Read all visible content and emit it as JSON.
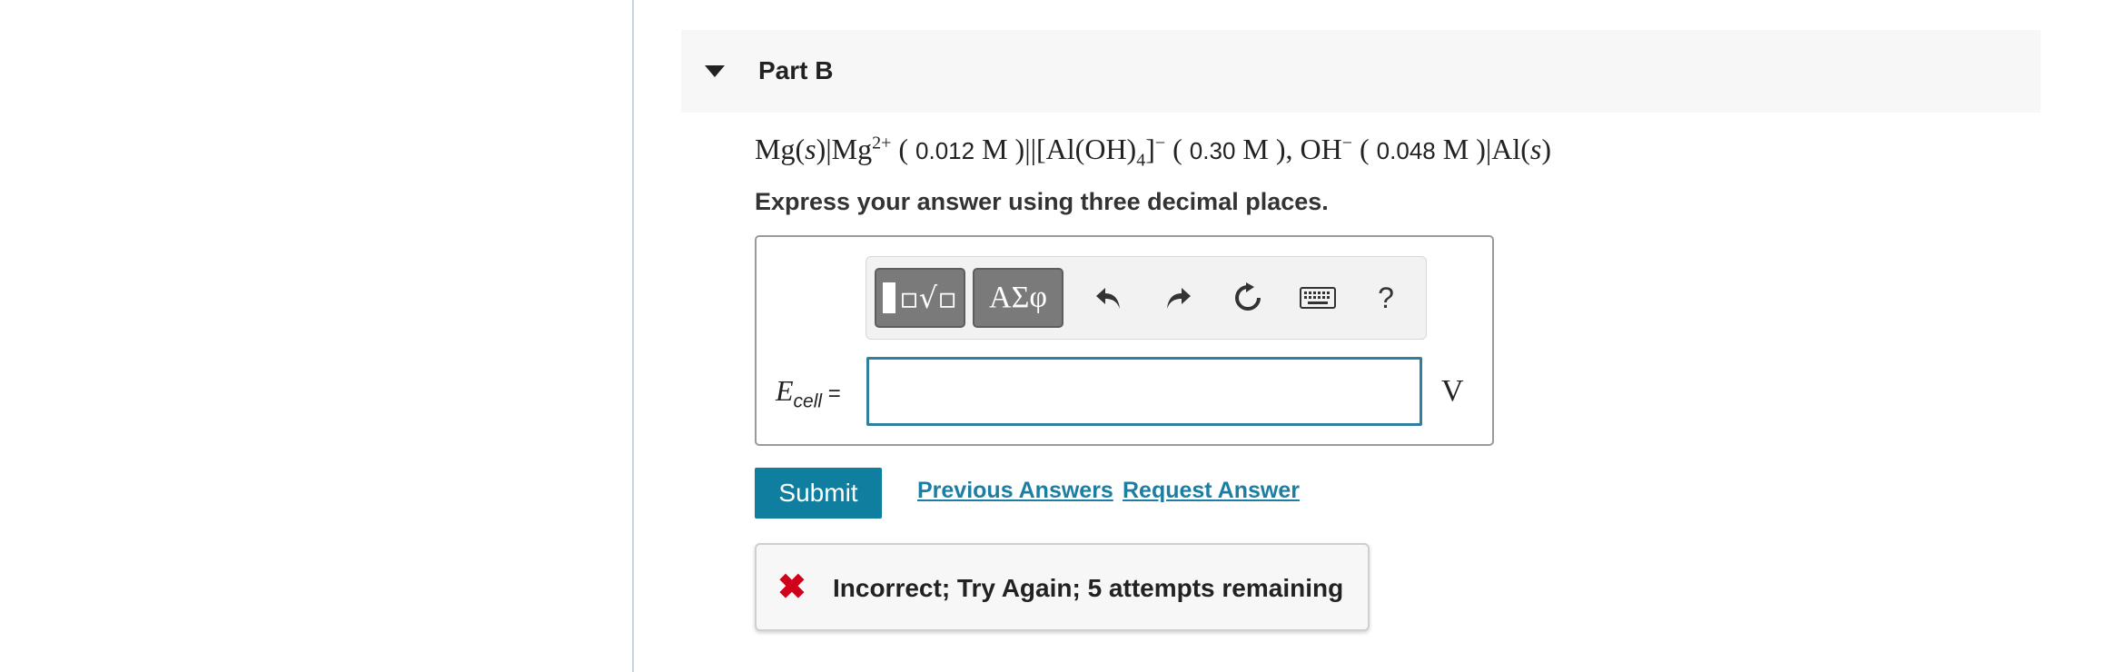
{
  "part": {
    "title": "Part B"
  },
  "equation": {
    "mg_s": "Mg(",
    "mg_s_var": "s",
    "mg_s_close": ")|Mg",
    "mg_charge": "2+",
    "conc1_open": " ( ",
    "conc1": "0.012",
    "conc1_unit": " M )||[Al(OH)",
    "sub4": "4",
    "complex_close": "]",
    "complex_charge": "−",
    "conc2_open": " ( ",
    "conc2": "0.30",
    "conc2_unit": " M ),  OH",
    "oh_charge": "−",
    "conc3_open": " ( ",
    "conc3": "0.048",
    "conc3_unit": " M )|Al(",
    "al_var": "s",
    "al_close": ")"
  },
  "instruction": "Express your answer using three decimal places.",
  "toolbar": {
    "greek_label": "ΑΣφ",
    "help_label": "?"
  },
  "answer": {
    "label_main": "E",
    "label_sub": "cell",
    "label_eq": " =",
    "value": "",
    "unit": "V"
  },
  "actions": {
    "submit_label": "Submit",
    "previous_answers_label": "Previous Answers",
    "request_answer_label": "Request Answer"
  },
  "feedback": {
    "text": "Incorrect; Try Again; 5 attempts remaining",
    "status_color": "#d0021b"
  },
  "colors": {
    "accent": "#0f7e9f",
    "link": "#1c7ea3",
    "input_border": "#2f7f9f"
  }
}
